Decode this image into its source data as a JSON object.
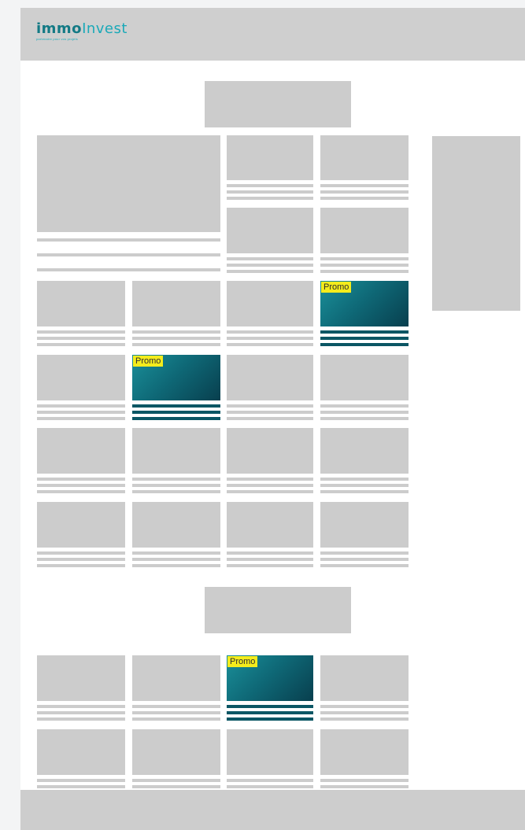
{
  "header": {
    "logo_bold": "immo",
    "logo_light": "Invest",
    "logo_tagline": "partenaire pour vos projets"
  },
  "promo_label": "Promo",
  "colors": {
    "placeholder": "#cccccc",
    "header_bg": "#cfcfcf",
    "promo_badge": "#f4ec1c",
    "promo_tile_from": "#1a8f99",
    "promo_tile_to": "#083f4e",
    "logo_teal": "#137a85"
  }
}
